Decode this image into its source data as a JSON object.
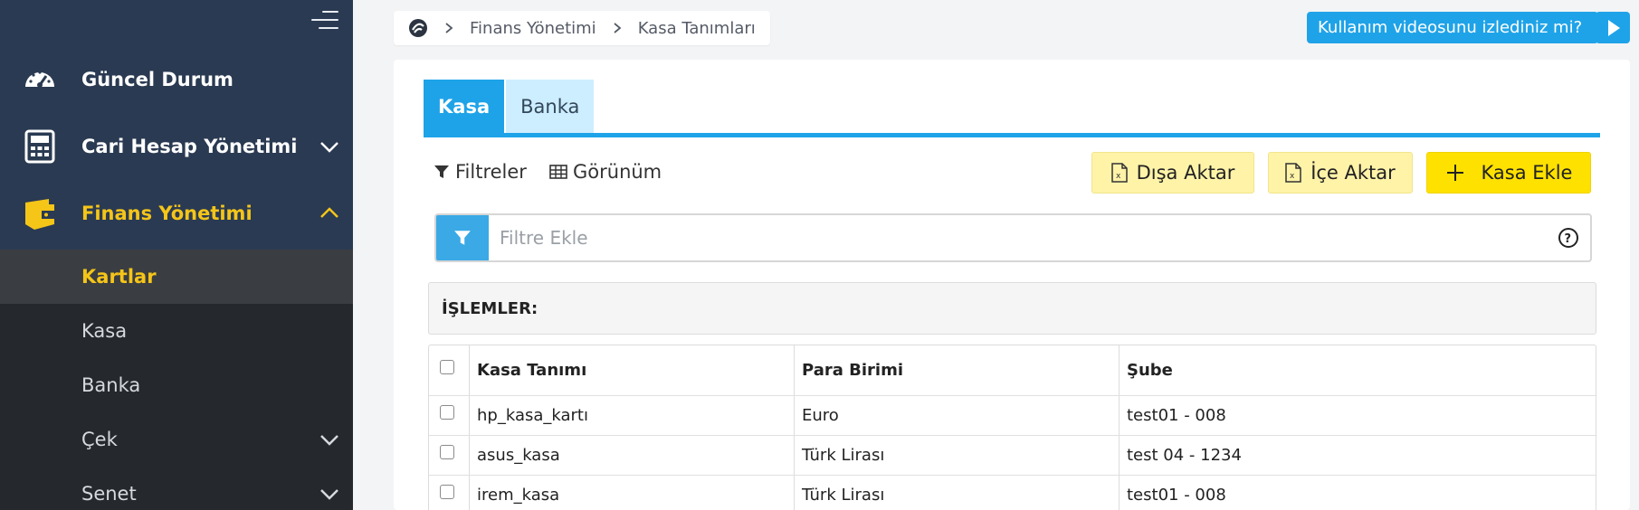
{
  "sidebar": {
    "main_items": [
      {
        "label": "Güncel Durum",
        "icon": "speedometer-icon"
      },
      {
        "label": "Cari Hesap Yönetimi",
        "icon": "calculator-icon",
        "chevron": "chevron-down-icon"
      },
      {
        "label": "Finans Yönetimi",
        "icon": "wallet-icon",
        "chevron": "chevron-up-icon",
        "active": true
      }
    ],
    "sub_items": [
      {
        "label": "Kartlar",
        "selected": true
      },
      {
        "label": "Kasa"
      },
      {
        "label": "Banka"
      },
      {
        "label": "Çek",
        "chevron": "chevron-down-icon"
      },
      {
        "label": "Senet",
        "chevron": "chevron-down-icon"
      }
    ],
    "active_color": "#f5c518"
  },
  "breadcrumb": {
    "items": [
      "Finans Yönetimi",
      "Kasa Tanımları"
    ]
  },
  "video_help": {
    "label": "Kullanım videosunu izlediniz mi?"
  },
  "tabs": [
    {
      "label": "Kasa",
      "active": true
    },
    {
      "label": "Banka",
      "active": false
    }
  ],
  "toolbar": {
    "filters_label": "Filtreler",
    "view_label": "Görünüm",
    "export_label": "Dışa Aktar",
    "import_label": "İçe Aktar",
    "add_label": "Kasa Ekle"
  },
  "filter": {
    "placeholder": "Filtre Ekle"
  },
  "operations": {
    "label": "İŞLEMLER:"
  },
  "table": {
    "columns": [
      "Kasa Tanımı",
      "Para Birimi",
      "Şube"
    ],
    "rows": [
      [
        "hp_kasa_kartı",
        "Euro",
        "test01 - 008"
      ],
      [
        "asus_kasa",
        "Türk Lirası",
        "test 04 - 1234"
      ],
      [
        "irem_kasa",
        "Türk Lirası",
        "test01 - 008"
      ]
    ]
  },
  "colors": {
    "accent": "#1fa3e8",
    "primary_button": "#ffe100",
    "soft_button": "#fff3a8"
  }
}
